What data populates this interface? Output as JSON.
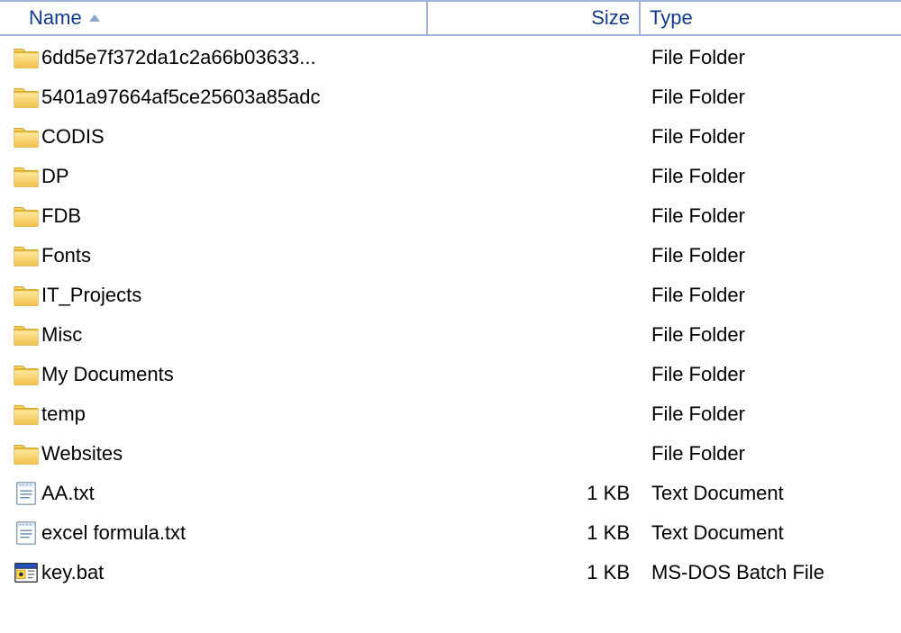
{
  "header": {
    "name": "Name",
    "size": "Size",
    "type": "Type",
    "sort_column": "name",
    "sort_direction": "asc"
  },
  "items": [
    {
      "name": "6dd5e7f372da1c2a66b03633...",
      "size": "",
      "type": "File Folder",
      "icon": "folder"
    },
    {
      "name": "5401a97664af5ce25603a85adc",
      "size": "",
      "type": "File Folder",
      "icon": "folder"
    },
    {
      "name": "CODIS",
      "size": "",
      "type": "File Folder",
      "icon": "folder"
    },
    {
      "name": "DP",
      "size": "",
      "type": "File Folder",
      "icon": "folder"
    },
    {
      "name": "FDB",
      "size": "",
      "type": "File Folder",
      "icon": "folder"
    },
    {
      "name": "Fonts",
      "size": "",
      "type": "File Folder",
      "icon": "folder"
    },
    {
      "name": "IT_Projects",
      "size": "",
      "type": "File Folder",
      "icon": "folder"
    },
    {
      "name": "Misc",
      "size": "",
      "type": "File Folder",
      "icon": "folder"
    },
    {
      "name": "My Documents",
      "size": "",
      "type": "File Folder",
      "icon": "folder"
    },
    {
      "name": "temp",
      "size": "",
      "type": "File Folder",
      "icon": "folder"
    },
    {
      "name": "Websites",
      "size": "",
      "type": "File Folder",
      "icon": "folder"
    },
    {
      "name": "AA.txt",
      "size": "1 KB",
      "type": "Text Document",
      "icon": "text"
    },
    {
      "name": "excel formula.txt",
      "size": "1 KB",
      "type": "Text Document",
      "icon": "text"
    },
    {
      "name": "key.bat",
      "size": "1 KB",
      "type": "MS-DOS Batch File",
      "icon": "bat"
    }
  ]
}
